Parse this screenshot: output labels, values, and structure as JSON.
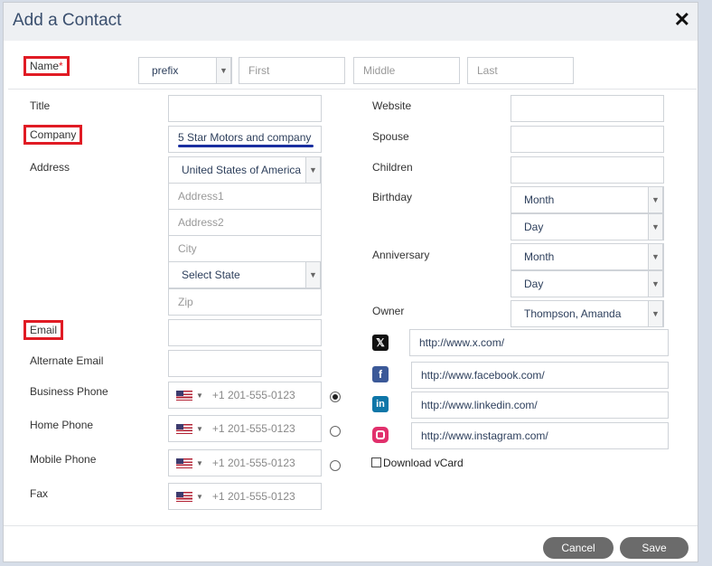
{
  "dialog": {
    "title": "Add a Contact",
    "close_glyph": "✕",
    "name": {
      "label": "Name",
      "required_mark": "*",
      "prefix_value": "prefix",
      "first_placeholder": "First",
      "middle_placeholder": "Middle",
      "last_placeholder": "Last"
    },
    "left": {
      "title_label": "Title",
      "company_label": "Company",
      "company_value": "5 Star Motors and company",
      "address_label": "Address",
      "country_value": "United States of America",
      "address1_placeholder": "Address1",
      "address2_placeholder": "Address2",
      "city_placeholder": "City",
      "state_value": "Select State",
      "zip_placeholder": "Zip",
      "email_label": "Email",
      "alt_email_label": "Alternate Email",
      "business_phone_label": "Business Phone",
      "home_phone_label": "Home Phone",
      "mobile_phone_label": "Mobile Phone",
      "fax_label": "Fax",
      "phone_placeholder": "+1 201-555-0123"
    },
    "right": {
      "website_label": "Website",
      "spouse_label": "Spouse",
      "children_label": "Children",
      "birthday_label": "Birthday",
      "anniversary_label": "Anniversary",
      "month_value": "Month",
      "day_value": "Day",
      "owner_label": "Owner",
      "owner_value": "Thompson, Amanda",
      "x_url": "http://www.x.com/",
      "facebook_url": "http://www.facebook.com/",
      "linkedin_url": "http://www.linkedin.com/",
      "instagram_url": "http://www.instagram.com/",
      "download_vcard_label": "Download vCard"
    },
    "buttons": {
      "cancel": "Cancel",
      "save": "Save"
    }
  },
  "colors": {
    "highlight_red": "#e01b24",
    "underline_blue": "#1a2fa0",
    "button_gray": "#6b6b6b",
    "facebook_blue": "#3b5998",
    "linkedin_blue": "#0e76a8",
    "instagram_orange": "#e1306c"
  }
}
